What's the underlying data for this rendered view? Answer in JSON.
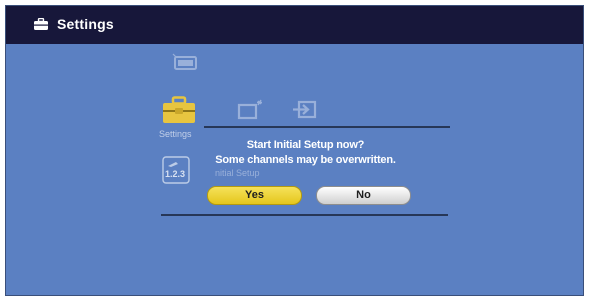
{
  "window": {
    "title": "Settings"
  },
  "menu": {
    "settings_label": "Settings",
    "initial_setup_icon_text": "1.2.3",
    "initial_setup_label": "nitial Setup"
  },
  "dialog": {
    "line1": "Start Initial Setup now?",
    "line2": "Some channels may be overwritten.",
    "yes_label": "Yes",
    "no_label": "No"
  },
  "colors": {
    "background": "#5b80c2",
    "titlebar": "#17173a",
    "accent_icon": "#e7c540",
    "yes_button": "#f0d63a",
    "no_button": "#e8e8e8"
  }
}
